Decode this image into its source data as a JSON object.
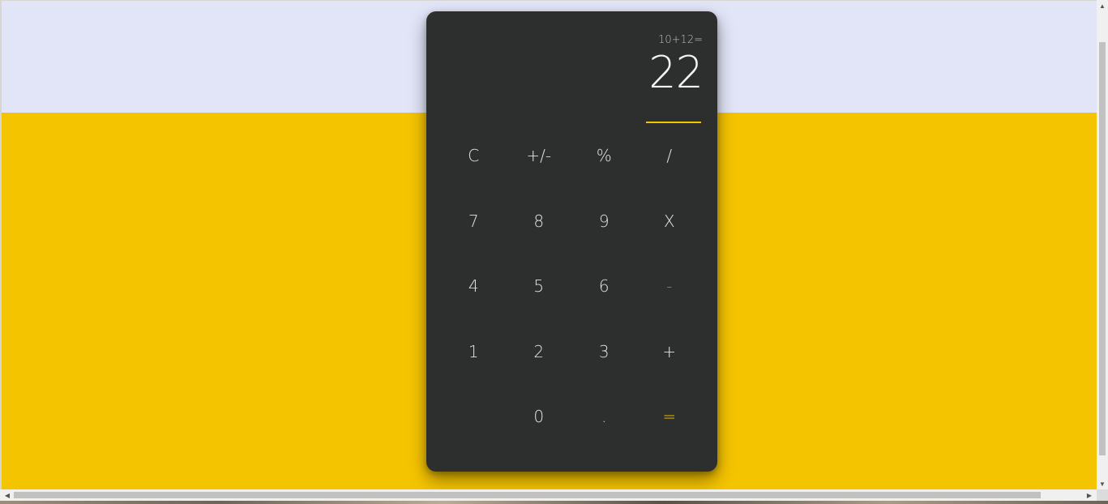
{
  "colors": {
    "page_top": "#e1e5f7",
    "page_bottom": "#f5c400",
    "calculator_body": "#2d2f2f",
    "accent": "#f5c400",
    "key_text": "#e2e2e2",
    "expression_text": "#bcbcbc"
  },
  "display": {
    "expression": "10+12=",
    "result": "22"
  },
  "keys": {
    "row1": [
      "C",
      "+/-",
      "%",
      "/"
    ],
    "row2": [
      "7",
      "8",
      "9",
      "X"
    ],
    "row3": [
      "4",
      "5",
      "6",
      "-"
    ],
    "row4": [
      "1",
      "2",
      "3",
      "+"
    ],
    "row5": [
      "",
      "0",
      ".",
      "="
    ]
  },
  "scrollbars": {
    "up_icon": "triangle-up-icon",
    "down_icon": "triangle-down-icon",
    "left_icon": "triangle-left-icon",
    "right_icon": "triangle-right-icon"
  }
}
